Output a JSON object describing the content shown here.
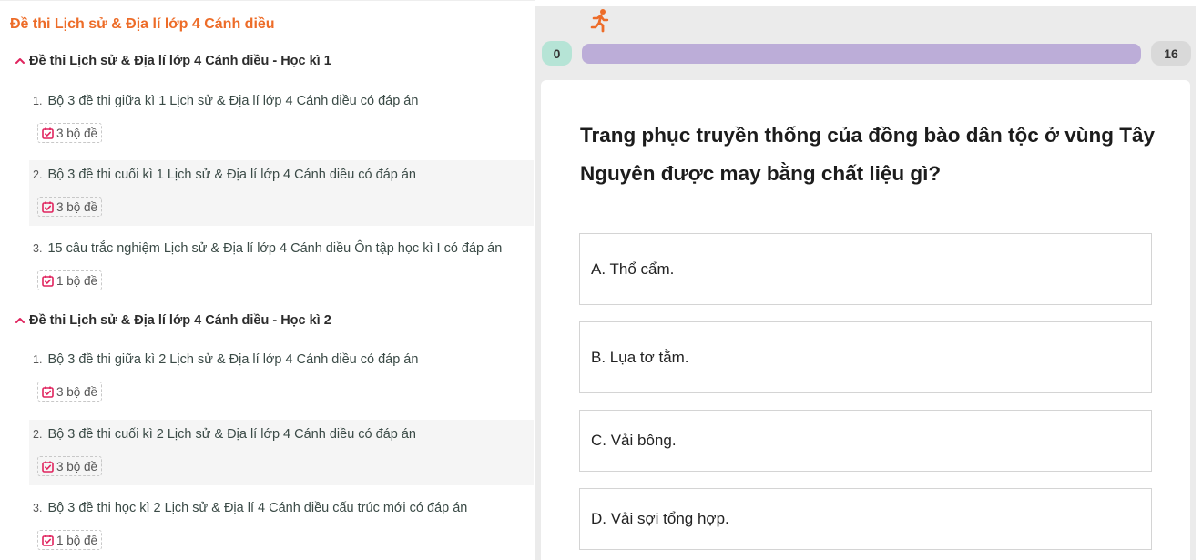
{
  "left_panel": {
    "title": "Đề thi Lịch sử & Địa lí lớp 4 Cánh diều",
    "sections": [
      {
        "heading": "Đề thi Lịch sử & Địa lí lớp 4 Cánh diều - Học kì 1",
        "items": [
          {
            "num": "1.",
            "title": "Bộ 3 đề thi giữa kì 1 Lịch sử & Địa lí lớp 4 Cánh diều có đáp án",
            "badge": "3 bộ đề"
          },
          {
            "num": "2.",
            "title": "Bộ 3 đề thi cuối kì 1 Lịch sử & Địa lí lớp 4 Cánh diều có đáp án",
            "badge": "3 bộ đề"
          },
          {
            "num": "3.",
            "title": "15 câu trắc nghiệm Lịch sử & Địa lí lớp 4 Cánh diều Ôn tập học kì I có đáp án",
            "badge": "1 bộ đề"
          }
        ]
      },
      {
        "heading": "Đề thi Lịch sử & Địa lí lớp 4 Cánh diều - Học kì 2",
        "items": [
          {
            "num": "1.",
            "title": "Bộ 3 đề thi giữa kì 2 Lịch sử & Địa lí lớp 4 Cánh diều có đáp án",
            "badge": "3 bộ đề"
          },
          {
            "num": "2.",
            "title": "Bộ 3 đề thi cuối kì 2 Lịch sử & Địa lí lớp 4 Cánh diều có đáp án",
            "badge": "3 bộ đề"
          },
          {
            "num": "3.",
            "title": "Bộ 3 đề thi học kì 2 Lịch sử & Địa lí 4 Cánh diều cấu trúc mới có đáp án",
            "badge": "1 bộ đề"
          }
        ]
      }
    ]
  },
  "quiz": {
    "answered_count": "0",
    "total_count": "16",
    "progress_fraction": 0,
    "question": "Trang phục truyền thống của đồng bào dân tộc ở vùng Tây Nguyên được may bằng chất liệu gì?",
    "options": [
      "A. Thổ cẩm.",
      "B. Lụa tơ tằm.",
      "C. Vải bông.",
      "D. Vải sợi tổng hợp."
    ]
  },
  "colors": {
    "title_orange": "#ed6c28",
    "progress_track": "#bcadd8",
    "answered_pill": "#b6e4d6",
    "badge_icon": "#e0245e"
  },
  "icons": {
    "section_toggle": "chevron-up-icon",
    "badge": "calendar-check-icon",
    "progress_marker": "runner-icon"
  }
}
